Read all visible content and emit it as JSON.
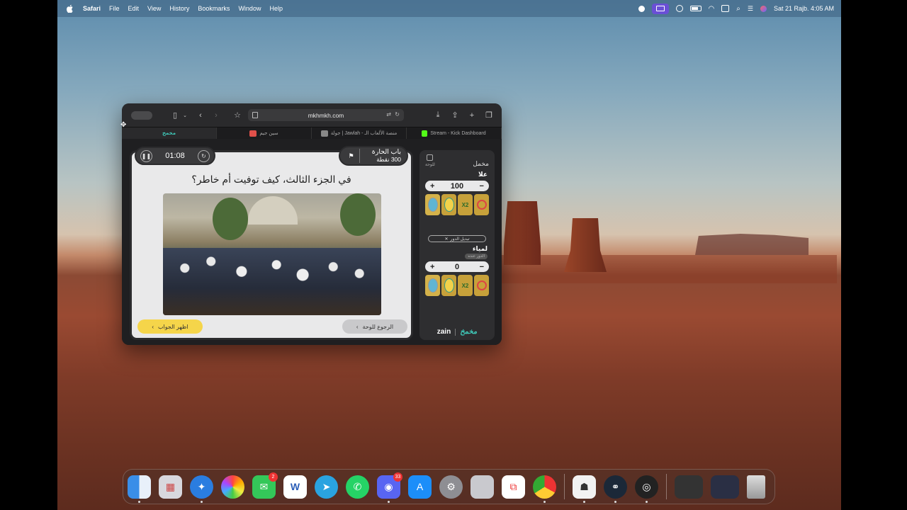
{
  "menubar": {
    "app_name": "Safari",
    "items": [
      "File",
      "Edit",
      "View",
      "History",
      "Bookmarks",
      "Window",
      "Help"
    ],
    "date_time": "Sat 21 Rajb.  4:05 AM"
  },
  "browser": {
    "url": "mkhmkh.com",
    "tabs": [
      {
        "label": "مخمخ",
        "active": true,
        "color": "#3fc8b8"
      },
      {
        "label": "سين جيم",
        "active": false,
        "color": "#e0504a"
      },
      {
        "label": "جولة | Jawlah - منصة الألعاب الـ",
        "active": false,
        "color": "#888888"
      },
      {
        "label": "Stream - Kick Dashboard",
        "active": false,
        "color": "#53fc18"
      }
    ]
  },
  "game": {
    "timer": "01:08",
    "category": "باب الحارة",
    "points": "300 نقطة",
    "question": "في الجزء الثالث، كيف توفيت أم خاطر؟",
    "back_button": "الرجوع للوحة",
    "answer_button": "اظهر الجواب"
  },
  "panel": {
    "exit_label": "للوحة",
    "mode_label": "مخمل",
    "teams": [
      {
        "name": "علا",
        "score": "100"
      },
      {
        "name": "لمياء",
        "score": "0",
        "tag": "الدور عنده"
      }
    ],
    "turn_button": "تبديل الدور",
    "powers": [
      "",
      "",
      "X2",
      ""
    ],
    "logo_zain": "zain",
    "logo_brand": "مخمخ"
  },
  "dock": {
    "messages_badge": "2",
    "discord_badge": "33"
  }
}
